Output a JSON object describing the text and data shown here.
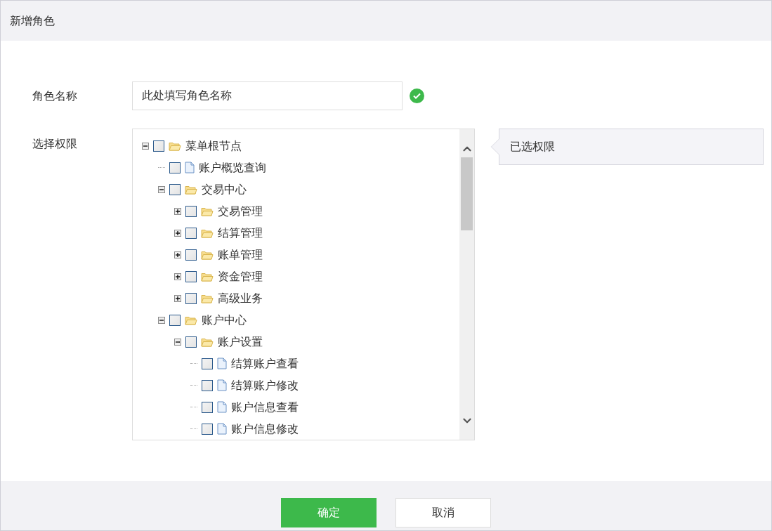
{
  "dialog": {
    "title": "新增角色"
  },
  "form": {
    "name_label": "角色名称",
    "name_value": "此处填写角色名称",
    "name_valid": true,
    "permissions_label": "选择权限"
  },
  "tree": [
    {
      "label": "菜单根节点",
      "kind": "folder",
      "checked": false,
      "expanded": true,
      "children": [
        {
          "label": "账户概览查询",
          "kind": "file",
          "checked": false
        },
        {
          "label": "交易中心",
          "kind": "folder",
          "checked": false,
          "expanded": true,
          "children": [
            {
              "label": "交易管理",
              "kind": "folder",
              "checked": false,
              "expanded": false
            },
            {
              "label": "结算管理",
              "kind": "folder",
              "checked": false,
              "expanded": false
            },
            {
              "label": "账单管理",
              "kind": "folder",
              "checked": false,
              "expanded": false
            },
            {
              "label": "资金管理",
              "kind": "folder",
              "checked": false,
              "expanded": false
            },
            {
              "label": "高级业务",
              "kind": "folder",
              "checked": false,
              "expanded": false
            }
          ]
        },
        {
          "label": "账户中心",
          "kind": "folder",
          "checked": false,
          "expanded": true,
          "children": [
            {
              "label": "账户设置",
              "kind": "folder",
              "checked": false,
              "expanded": true,
              "children": [
                {
                  "label": "结算账户查看",
                  "kind": "file",
                  "checked": false
                },
                {
                  "label": "结算账户修改",
                  "kind": "file",
                  "checked": false
                },
                {
                  "label": "账户信息查看",
                  "kind": "file",
                  "checked": false
                },
                {
                  "label": "账户信息修改",
                  "kind": "file",
                  "checked": false
                }
              ]
            }
          ]
        }
      ]
    }
  ],
  "selected_panel": {
    "title": "已选权限"
  },
  "buttons": [
    {
      "label": "确定",
      "kind": "primary"
    },
    {
      "label": "取消",
      "kind": "secondary"
    }
  ]
}
